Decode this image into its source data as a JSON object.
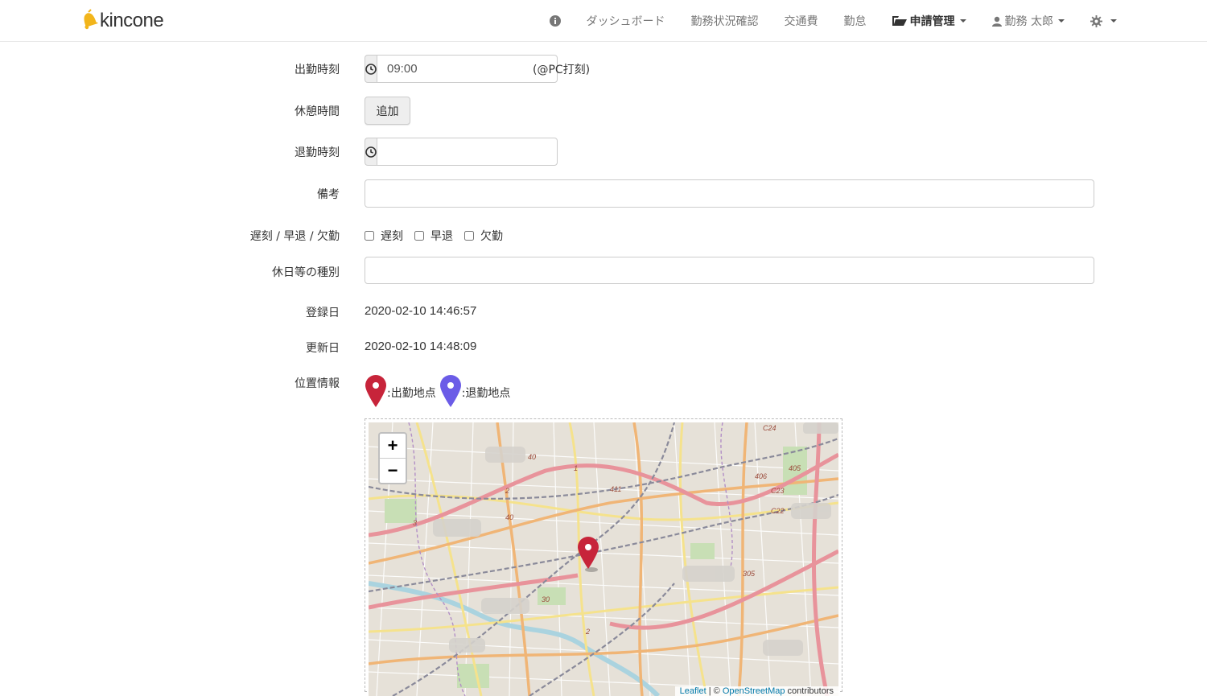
{
  "brand": {
    "name": "kincone",
    "color": "#f2b51b"
  },
  "nav": {
    "info_icon": "info-icon",
    "items": [
      {
        "label": "ダッシュボード"
      },
      {
        "label": "勤務状況確認"
      },
      {
        "label": "交通費"
      },
      {
        "label": "勤怠"
      }
    ],
    "applications": "申請管理",
    "user": "勤務 太郎",
    "settings_icon": "gear-icon"
  },
  "form": {
    "clock_in": {
      "label": "出勤時刻",
      "value": "09:00",
      "note": "(@PC打刻)"
    },
    "break": {
      "label": "休憩時間",
      "button": "追加"
    },
    "clock_out": {
      "label": "退勤時刻",
      "value": ""
    },
    "remarks": {
      "label": "備考",
      "value": ""
    },
    "late_early_absent": {
      "label": "遅刻 / 早退 / 欠勤",
      "options": [
        "遅刻",
        "早退",
        "欠勤"
      ]
    },
    "holiday_type": {
      "label": "休日等の種別",
      "value": ""
    },
    "registered": {
      "label": "登録日",
      "value": "2020-02-10 14:46:57"
    },
    "updated": {
      "label": "更新日",
      "value": "2020-02-10 14:48:09"
    },
    "location": {
      "label": "位置情報",
      "legend_in": ":出勤地点",
      "legend_out": ":退勤地点",
      "pin_in_color": "#c7243a",
      "pin_out_color": "#6b5ce7"
    }
  },
  "map": {
    "zoom_in": "+",
    "zoom_out": "−",
    "attr_leaflet": "Leaflet",
    "attr_sep": " | © ",
    "attr_osm": "OpenStreetMap",
    "attr_contrib": " contributors",
    "road_labels": [
      "40",
      "1",
      "2",
      "411",
      "406",
      "405",
      "C24",
      "C23",
      "C22",
      "3",
      "40",
      "305",
      "30",
      "2"
    ]
  }
}
